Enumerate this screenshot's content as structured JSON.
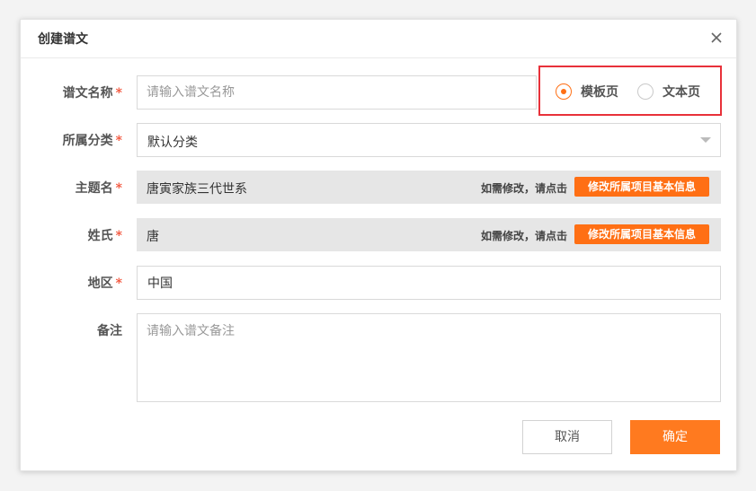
{
  "dialog": {
    "title": "创建谱文",
    "close_icon": "close-icon"
  },
  "form": {
    "name": {
      "label": "谱文名称",
      "required": "*",
      "placeholder": "请输入谱文名称",
      "value": ""
    },
    "page_type": {
      "options": [
        {
          "label": "模板页",
          "selected": true
        },
        {
          "label": "文本页",
          "selected": false
        }
      ]
    },
    "category": {
      "label": "所属分类",
      "required": "*",
      "value": "默认分类",
      "caret_icon": "chevron-down-icon"
    },
    "topic": {
      "label": "主题名",
      "required": "*",
      "value": "唐寅家族三代世系",
      "hint": "如需修改，请点击",
      "button": "修改所属项目基本信息"
    },
    "surname": {
      "label": "姓氏",
      "required": "*",
      "value": "唐",
      "hint": "如需修改，请点击",
      "button": "修改所属项目基本信息"
    },
    "region": {
      "label": "地区",
      "required": "*",
      "value": "中国"
    },
    "remark": {
      "label": "备注",
      "placeholder": "请输入谱文备注",
      "value": ""
    }
  },
  "footer": {
    "cancel_label": "取消",
    "ok_label": "确定"
  },
  "colors": {
    "accent": "#ff6f14",
    "required": "#f24b31",
    "highlight_border": "#e8313a",
    "readonly_bg": "#e6e6e6"
  }
}
